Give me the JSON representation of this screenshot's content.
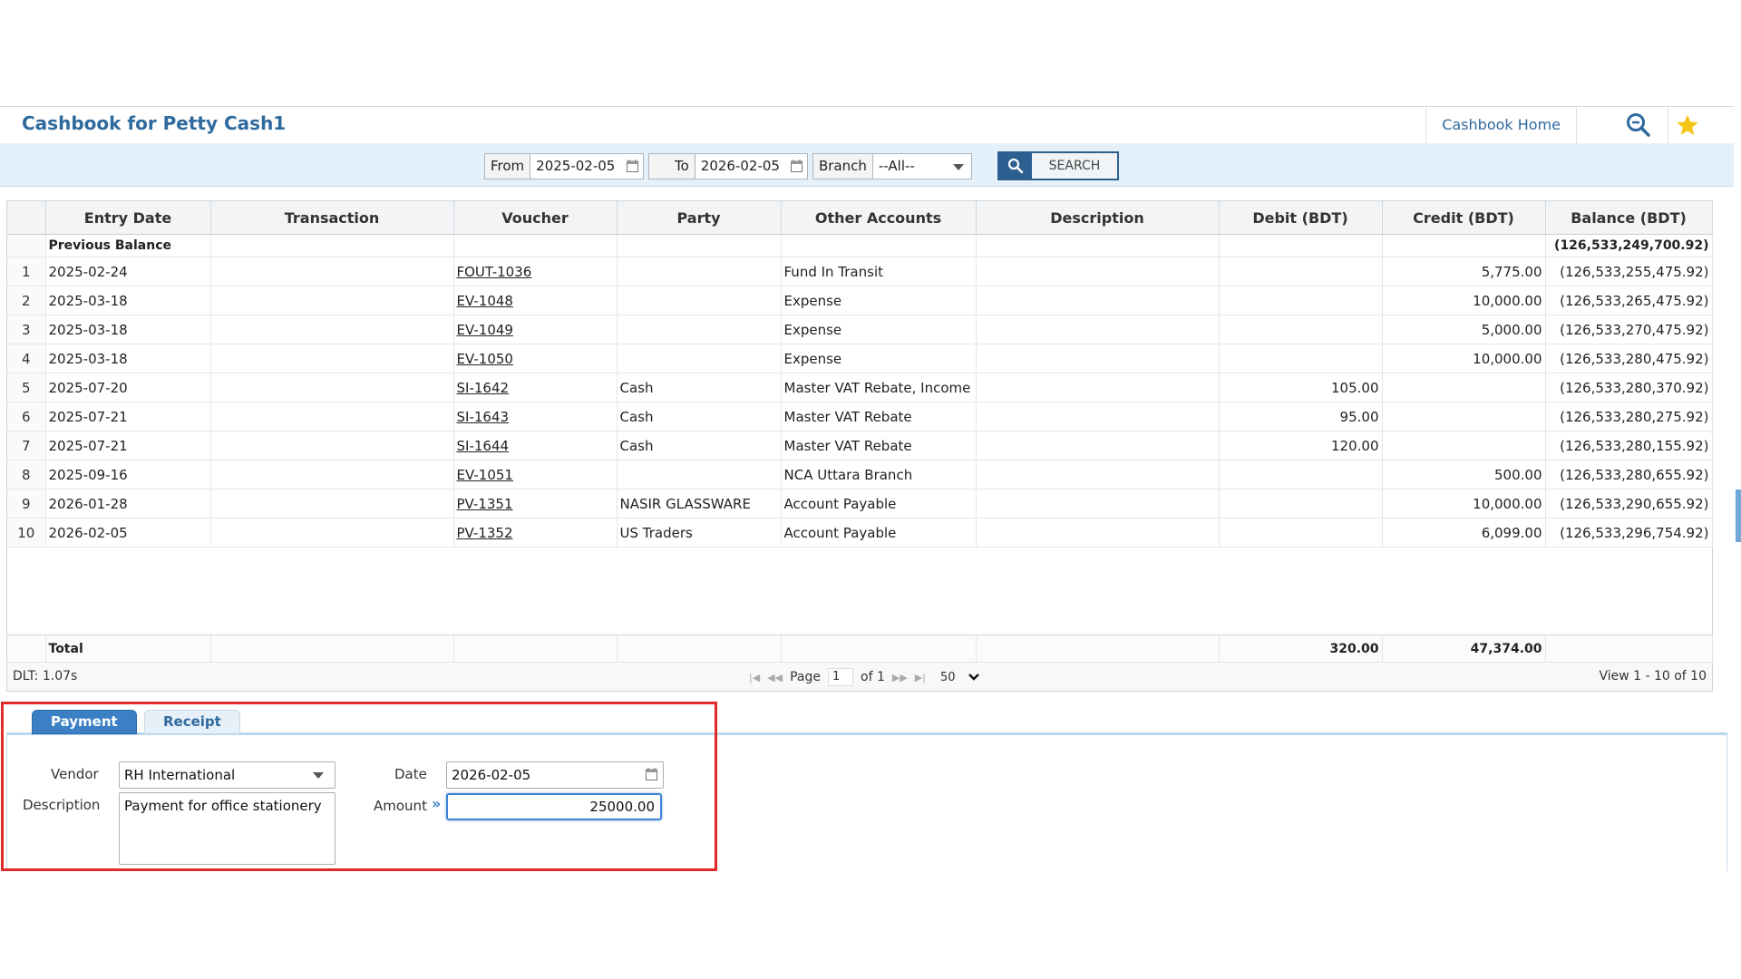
{
  "header": {
    "title": "Cashbook for Petty Cash1",
    "home_link": "Cashbook Home"
  },
  "filters": {
    "from_label": "From",
    "from_value": "2025-02-05",
    "to_label": "To",
    "to_value": "2026-02-05",
    "branch_label": "Branch",
    "branch_value": "--All--",
    "search_label": "SEARCH"
  },
  "grid": {
    "columns": [
      "Entry Date",
      "Transaction",
      "Voucher",
      "Party",
      "Other Accounts",
      "Description",
      "Debit (BDT)",
      "Credit (BDT)",
      "Balance (BDT)"
    ],
    "previous_balance": {
      "label": "Previous Balance",
      "balance": "(126,533,249,700.92)"
    },
    "rows": [
      {
        "n": "1",
        "date": "2025-02-24",
        "transaction": "",
        "voucher": "FOUT-1036",
        "party": "",
        "other": "Fund In Transit",
        "description": "",
        "debit": "",
        "credit": "5,775.00",
        "balance": "(126,533,255,475.92)"
      },
      {
        "n": "2",
        "date": "2025-03-18",
        "transaction": "",
        "voucher": "EV-1048",
        "party": "",
        "other": "Expense",
        "description": "",
        "debit": "",
        "credit": "10,000.00",
        "balance": "(126,533,265,475.92)"
      },
      {
        "n": "3",
        "date": "2025-03-18",
        "transaction": "",
        "voucher": "EV-1049",
        "party": "",
        "other": "Expense",
        "description": "",
        "debit": "",
        "credit": "5,000.00",
        "balance": "(126,533,270,475.92)"
      },
      {
        "n": "4",
        "date": "2025-03-18",
        "transaction": "",
        "voucher": "EV-1050",
        "party": "",
        "other": "Expense",
        "description": "",
        "debit": "",
        "credit": "10,000.00",
        "balance": "(126,533,280,475.92)"
      },
      {
        "n": "5",
        "date": "2025-07-20",
        "transaction": "",
        "voucher": "SI-1642",
        "party": "Cash",
        "other": "Master VAT Rebate, Income",
        "description": "",
        "debit": "105.00",
        "credit": "",
        "balance": "(126,533,280,370.92)"
      },
      {
        "n": "6",
        "date": "2025-07-21",
        "transaction": "",
        "voucher": "SI-1643",
        "party": "Cash",
        "other": "Master VAT Rebate",
        "description": "",
        "debit": "95.00",
        "credit": "",
        "balance": "(126,533,280,275.92)"
      },
      {
        "n": "7",
        "date": "2025-07-21",
        "transaction": "",
        "voucher": "SI-1644",
        "party": "Cash",
        "other": "Master VAT Rebate",
        "description": "",
        "debit": "120.00",
        "credit": "",
        "balance": "(126,533,280,155.92)"
      },
      {
        "n": "8",
        "date": "2025-09-16",
        "transaction": "",
        "voucher": "EV-1051",
        "party": "",
        "other": "NCA Uttara Branch",
        "description": "",
        "debit": "",
        "credit": "500.00",
        "balance": "(126,533,280,655.92)"
      },
      {
        "n": "9",
        "date": "2026-01-28",
        "transaction": "",
        "voucher": "PV-1351",
        "party": "NASIR GLASSWARE",
        "other": "Account Payable",
        "description": "",
        "debit": "",
        "credit": "10,000.00",
        "balance": "(126,533,290,655.92)"
      },
      {
        "n": "10",
        "date": "2026-02-05",
        "transaction": "",
        "voucher": "PV-1352",
        "party": "US Traders",
        "other": "Account Payable",
        "description": "",
        "debit": "",
        "credit": "6,099.00",
        "balance": "(126,533,296,754.92)"
      }
    ],
    "total": {
      "label": "Total",
      "debit": "320.00",
      "credit": "47,374.00"
    }
  },
  "pager": {
    "dlt": "DLT: 1.07s",
    "page_label": "Page",
    "page_value": "1",
    "of_label": "of 1",
    "page_size": "50",
    "view_text": "View 1 - 10 of 10"
  },
  "tabs": {
    "payment": "Payment",
    "receipt": "Receipt"
  },
  "form": {
    "vendor_label": "Vendor",
    "vendor_value": "RH International",
    "description_label": "Description",
    "description_value": "Payment for office stationery",
    "date_label": "Date",
    "date_value": "2026-02-05",
    "amount_label": "Amount",
    "amount_value": "25000.00"
  },
  "icons": {
    "search": "search-icon",
    "star": "star-icon",
    "calendar": "calendar-icon",
    "caret": "chevron-down-icon"
  },
  "colors": {
    "accent": "#2f6a9e",
    "tab_active": "#3b7fc4",
    "highlight_box": "#e02a2a"
  }
}
